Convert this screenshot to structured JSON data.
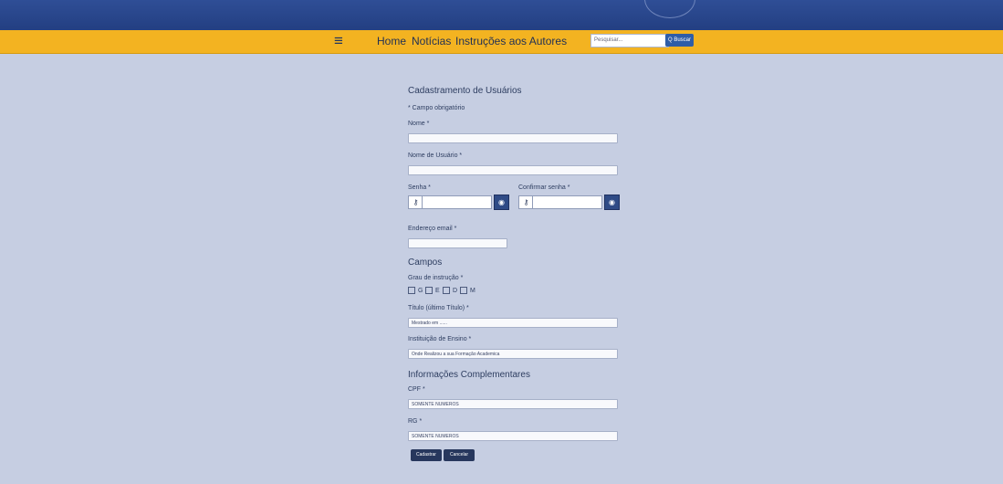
{
  "header": {
    "menu_icon": "≡",
    "search_placeholder": "Pesquisar...",
    "search_button": "Q Buscar",
    "nav": [
      "Home",
      "Notícias",
      "Instruções aos Autores"
    ]
  },
  "form": {
    "title": "Cadastramento de Usuários",
    "required_note": "* Campo obrigatório",
    "name_label": "Nome *",
    "username_label": "Nome de Usuário *",
    "password_label": "Senha *",
    "confirm_label": "Confirmar senha *",
    "email_label": "Endereço email *",
    "fields_title": "Campos",
    "degree_label": "Grau de instrução *",
    "degree_options": [
      "G",
      "E",
      "D",
      "M"
    ],
    "title_label": "Título (último Título) *",
    "title_placeholder": "Mestrado em ......",
    "institution_label": "Instituição de Ensino *",
    "institution_placeholder": "Onde Realizou a sua Formação Academica",
    "extra_title": "Informações Complementares",
    "cpf_label": "CPF *",
    "cpf_placeholder": "SOMENTE NUMEROS",
    "rg_label": "RG *",
    "rg_placeholder": "SOMENTE NUMEROS",
    "submit_button": "Cadastrar",
    "cancel_button": "Cancelar"
  },
  "colors": {
    "background": "#c6cee2",
    "topbar": "#233f82",
    "navbar": "#f3b321",
    "button": "#27375d"
  }
}
